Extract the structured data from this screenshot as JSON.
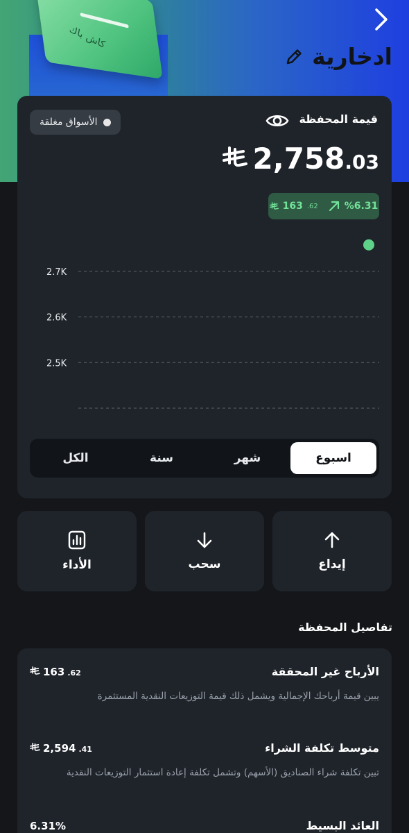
{
  "header": {
    "title": "ادخارية",
    "brand_text": "كاش باك"
  },
  "portfolio": {
    "market_status": "الأسواق مغلقة",
    "value_label": "قيمة المحفظة",
    "value_int": "2,758",
    "value_dec": ".03",
    "change_percent": "%6.31",
    "change_amount_int": "163",
    "change_amount_dec": ".62"
  },
  "chart_data": {
    "type": "line",
    "y_ticks": [
      "2.7K",
      "2.6K",
      "2.5K"
    ],
    "ylim": [
      2400,
      2750
    ],
    "series": [
      {
        "values": [
          2758,
          2758
        ],
        "x": [
          0,
          1
        ]
      }
    ],
    "grid": true
  },
  "range_tabs": [
    "اسبوع",
    "شهر",
    "سنة",
    "الكل"
  ],
  "actions": {
    "deposit": "إيداع",
    "withdraw": "سحب",
    "performance": "الأداء"
  },
  "details": {
    "section_title": "تفاصيل المحفظة",
    "rows": [
      {
        "title": "الأرباح غير المحققة",
        "value_int": "163",
        "value_dec": ".62",
        "desc": "يبين قيمة أرباحك الإجمالية ويشمل ذلك قيمة التوزيعات النقدية المستثمرة"
      },
      {
        "title": "متوسط تكلفة الشراء",
        "value_int": "2,594",
        "value_dec": ".41",
        "desc": "تبين تكلفة شراء الصناديق (الأسهم) وتشمل تكلفة إعادة استثمار التوزيعات النقدية"
      },
      {
        "title": "العائد البسيط",
        "value": "6.31%"
      }
    ]
  },
  "colors": {
    "accent_green": "#5fd28a",
    "card_bg": "#1f242b",
    "page_bg": "#141619"
  }
}
